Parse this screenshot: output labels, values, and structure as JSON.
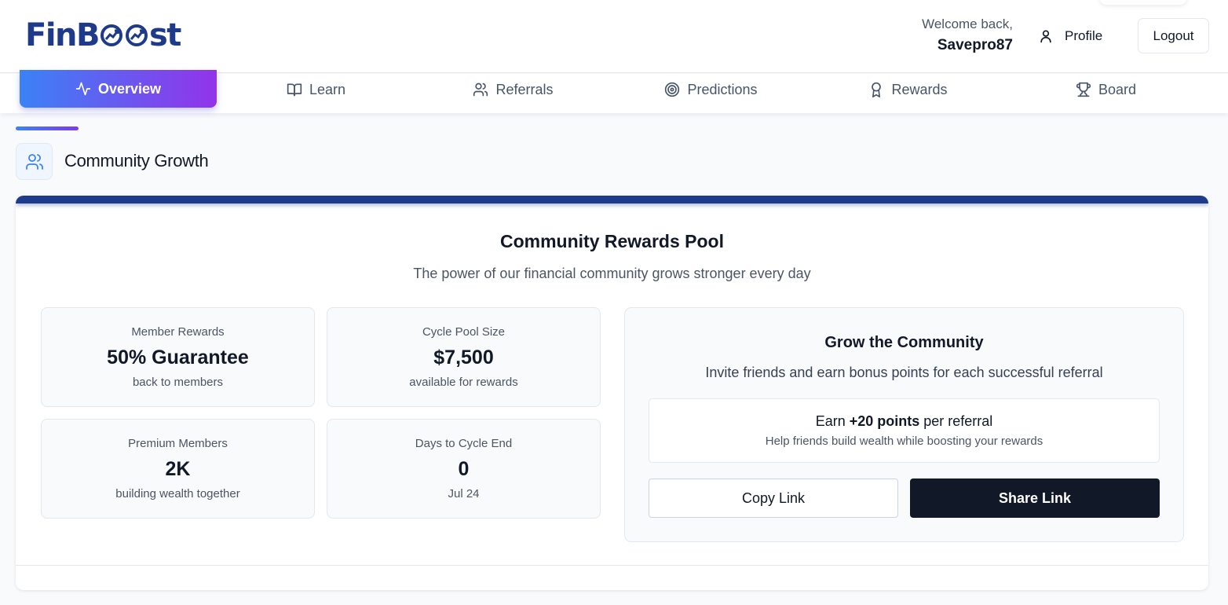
{
  "header": {
    "logo_prefix": "FinB",
    "logo_suffix": "st",
    "welcome_text": "Welcome back,",
    "username": "Savepro87",
    "profile_label": "Profile",
    "logout_label": "Logout"
  },
  "nav": {
    "tabs": [
      {
        "label": "Overview",
        "icon": "activity-icon",
        "active": true
      },
      {
        "label": "Learn",
        "icon": "book-open-icon",
        "active": false
      },
      {
        "label": "Referrals",
        "icon": "users-icon",
        "active": false
      },
      {
        "label": "Predictions",
        "icon": "target-icon",
        "active": false
      },
      {
        "label": "Rewards",
        "icon": "award-icon",
        "active": false
      },
      {
        "label": "Board",
        "icon": "trophy-icon",
        "active": false
      }
    ]
  },
  "section": {
    "title": "Community Growth",
    "icon": "users-icon"
  },
  "pool": {
    "title": "Community Rewards Pool",
    "subtitle": "The power of our financial community grows stronger every day",
    "stats": [
      {
        "label": "Member Rewards",
        "value": "50% Guarantee",
        "note": "back to members"
      },
      {
        "label": "Cycle Pool Size",
        "value": "$7,500",
        "note": "available for rewards"
      },
      {
        "label": "Premium Members",
        "value": "2K",
        "note": "building wealth together"
      },
      {
        "label": "Days to Cycle End",
        "value": "0",
        "note": "Jul 24"
      }
    ]
  },
  "grow": {
    "title": "Grow the Community",
    "subtitle": "Invite friends and earn bonus points for each successful referral",
    "earn_prefix": "Earn ",
    "earn_bold": "+20 points",
    "earn_suffix": " per referral",
    "earn_sub": "Help friends build wealth while boosting your rewards",
    "copy_label": "Copy Link",
    "share_label": "Share Link"
  },
  "colors": {
    "brand": "#1e3a8a",
    "gradient_start": "#3b82f6",
    "gradient_end": "#9333ea",
    "dark_button": "#111827"
  }
}
